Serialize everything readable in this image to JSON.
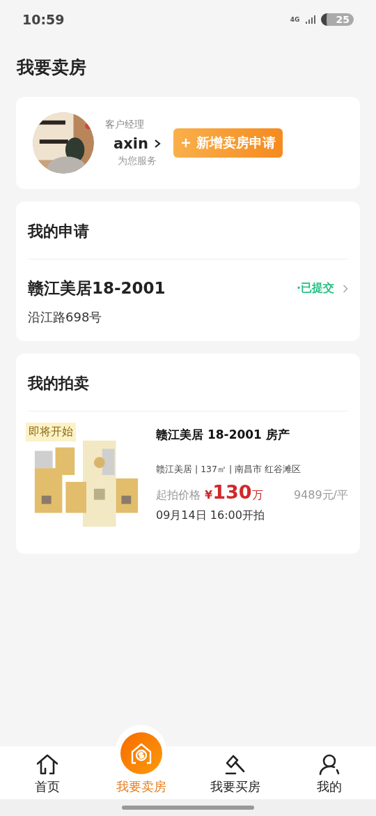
{
  "status_bar": {
    "time": "10:59",
    "network": "4G",
    "battery": "25"
  },
  "page_title": "我要卖房",
  "manager": {
    "role": "客户经理",
    "name": "axin",
    "note": "为您服务",
    "action": "+ 新增卖房申请"
  },
  "applications": {
    "title": "我的申请",
    "items": [
      {
        "name": "赣江美居18-2001",
        "address": "沿江路698号",
        "status": "·已提交"
      }
    ]
  },
  "auctions": {
    "title": "我的拍卖",
    "items": [
      {
        "badge": "即将开始",
        "title": "赣江美居 18-2001 房产",
        "details": "赣江美居 | 137㎡ | 南昌市 红谷滩区",
        "price_label": "起拍价格",
        "currency": "¥",
        "price": "130",
        "unit": "万",
        "unit_price": "9489元/平",
        "start": "09月14日 16:00开拍"
      }
    ]
  },
  "tab_bar": [
    {
      "label": "首页",
      "kind": "home",
      "selected": false
    },
    {
      "label": "我要卖房",
      "kind": "sell",
      "selected": true
    },
    {
      "label": "我要买房",
      "kind": "buy",
      "selected": false
    },
    {
      "label": "我的",
      "kind": "account",
      "selected": false
    }
  ]
}
